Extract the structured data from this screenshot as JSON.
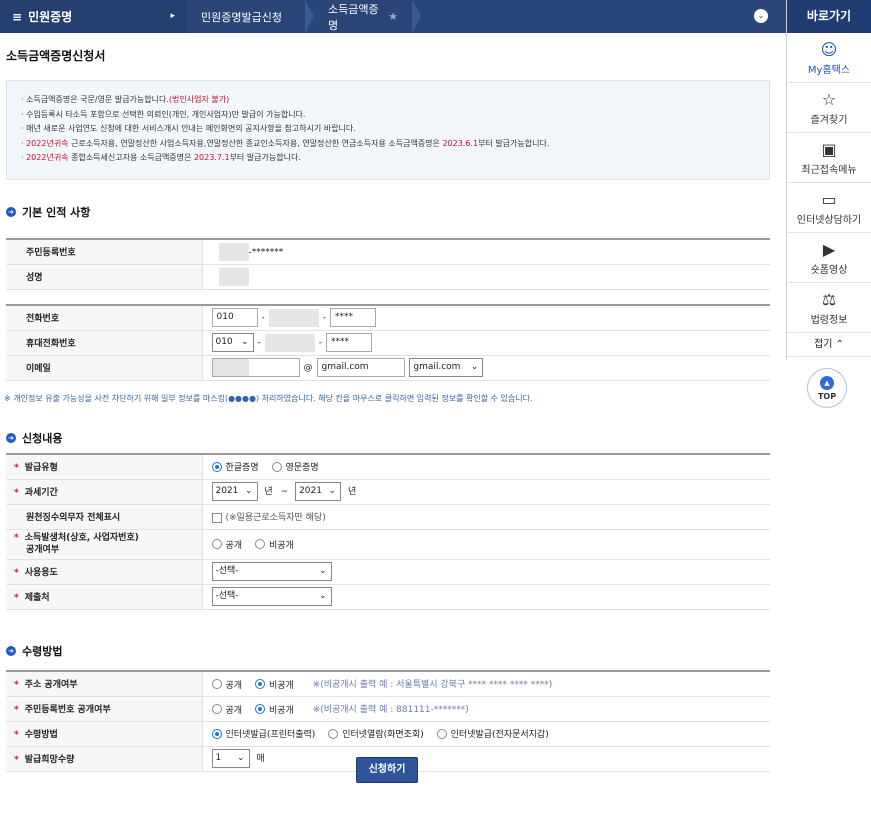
{
  "nav": {
    "menu_label": "민원증명",
    "crumb1": "민원증명발급신청",
    "crumb2": "소득금액증명"
  },
  "quick": {
    "title": "바로가기",
    "items": [
      {
        "label": "My홈택스",
        "icon": "user-icon"
      },
      {
        "label": "즐겨찾기",
        "icon": "star-icon"
      },
      {
        "label": "최근접속메뉴",
        "icon": "recent-icon"
      },
      {
        "label": "인터넷상담하기",
        "icon": "laptop-icon"
      },
      {
        "label": "숏폼영상",
        "icon": "play-icon"
      },
      {
        "label": "법령정보",
        "icon": "gavel-icon"
      }
    ],
    "fold": "접기",
    "top": "TOP"
  },
  "page": {
    "title": "소득금액증명신청서"
  },
  "notice": {
    "line1_a": "소득금액증명은 국문/영문 발급가능합니다.",
    "line1_b": "(법인사업자 불가)",
    "line2": "수입등록시 타소득 포함으로 선택한 의뢰인(개인, 개인사업자)만 발급이 가능합니다.",
    "line3": "매년 새로운 사업연도 신청에 대한 서비스개시 안내는 메인화면의 공지사항을 참고하시기 바랍니다.",
    "line4_a": "2022년귀속",
    "line4_b": " 근로소득자용, 연말정산한 사업소득자용,연말정산한 종교인소득자용, 연말정산한 연금소득자용 소득금액증명은 ",
    "line4_c": "2023.6.1",
    "line4_d": "부터 발급가능합니다.",
    "line5_a": "2022년귀속",
    "line5_b": " 종합소득세신고자용 소득금액증명은 ",
    "line5_c": "2023.7.1",
    "line5_d": "부터 발급가능합니다."
  },
  "section1": {
    "title": "기본 인적 사항",
    "rrn_label": "주민등록번호",
    "rrn_value": "-*******",
    "name_label": "성명",
    "phone_label": "전화번호",
    "phone1": "010",
    "phone3": "****",
    "mobile_label": "휴대전화번호",
    "mobile1": "010",
    "mobile3": "****",
    "email_label": "이메일",
    "email_at": "@",
    "email_domain": "gmail.com",
    "email_select": "gmail.com",
    "privacy_note": "※ 개인정보 유출 가능성을 사전 차단하기 위해 일부 정보를 마스킹(●●●●) 처리하였습니다. 해당 칸을 마우스로 클릭하면 입력된 정보를 확인할 수 있습니다."
  },
  "section2": {
    "title": "신청내용",
    "type_label": "발급유형",
    "type_opt1": "한글증명",
    "type_opt2": "영문증명",
    "period_label": "과세기간",
    "period_from": "2021",
    "period_to": "2021",
    "year_unit": "년",
    "tilde": "~",
    "withhold_label": "원천징수의무자 전체표시",
    "withhold_hint": "(※일용근로소득자만 해당)",
    "source_label_1": "소득발생처(상호, 사업자번호)",
    "source_label_2": "공개여부",
    "open": "공개",
    "closed": "비공개",
    "use_label": "사용용도",
    "use_value": "-선택-",
    "submit_label": "제출처",
    "submit_value": "-선택-"
  },
  "section3": {
    "title": "수령방법",
    "addr_label": "주소 공개여부",
    "addr_example": "※(비공개시 출력 예 : 서울특별시 강북구 **** **** **** ****)",
    "rrn_label": "주민등록번호 공개여부",
    "rrn_example": "※(비공개시 출력 예 : 881111-*******)",
    "method_label": "수령방법",
    "method_opt1": "인터넷발급(프린터출력)",
    "method_opt2": "인터넷열람(화면조회)",
    "method_opt3": "인터넷발급(전자문서지갑)",
    "copies_label": "발급희망수량",
    "copies_value": "1",
    "copies_unit": "매"
  },
  "submit_button": "신청하기",
  "colors": {
    "nav_bg": "#2a4679",
    "quick_head": "#1e3c72",
    "accent": "#1c5bc4",
    "required": "#d0102e"
  }
}
